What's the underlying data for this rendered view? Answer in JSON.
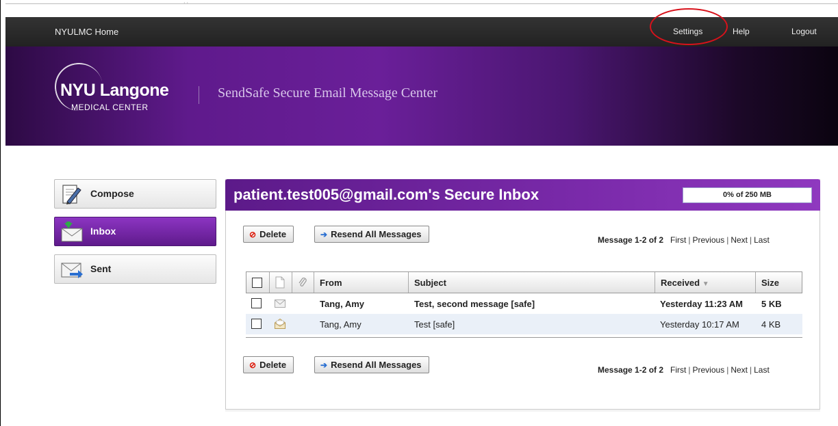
{
  "topbar": {
    "home_label": "NYULMC Home",
    "settings_label": "Settings",
    "help_label": "Help",
    "logout_label": "Logout",
    "annotation_color": "#d8121b"
  },
  "banner": {
    "logo_name": "NYU Langone",
    "logo_sub": "MEDICAL CENTER",
    "app_title": "SendSafe Secure Email Message Center"
  },
  "sidebar": {
    "items": [
      {
        "label": "Compose",
        "icon": "compose-icon",
        "active": false
      },
      {
        "label": "Inbox",
        "icon": "inbox-icon",
        "active": true
      },
      {
        "label": "Sent",
        "icon": "sent-icon",
        "active": false
      }
    ]
  },
  "inbox": {
    "title": "patient.test005@gmail.com's Secure Inbox",
    "quota_label": "0% of 250 MB",
    "quota_fraction": 0.0,
    "toolbar": {
      "delete_label": "Delete",
      "resend_label": "Resend All Messages"
    },
    "pager": {
      "count_label": "Message 1-2 of 2",
      "first_label": "First",
      "previous_label": "Previous",
      "next_label": "Next",
      "last_label": "Last"
    },
    "columns": {
      "from": "From",
      "subject": "Subject",
      "received": "Received",
      "size": "Size"
    },
    "messages": [
      {
        "from": "Tang, Amy",
        "subject": "Test, second message [safe]",
        "received": "Yesterday 11:23 AM",
        "size": "5 KB",
        "unread": true,
        "icon": "envelope-closed-icon"
      },
      {
        "from": "Tang, Amy",
        "subject": "Test [safe]",
        "received": "Yesterday 10:17 AM",
        "size": "4 KB",
        "unread": false,
        "icon": "envelope-open-icon"
      }
    ]
  },
  "colors": {
    "brand_purple": "#6a1f99",
    "topbar": "#2a2a2a"
  }
}
